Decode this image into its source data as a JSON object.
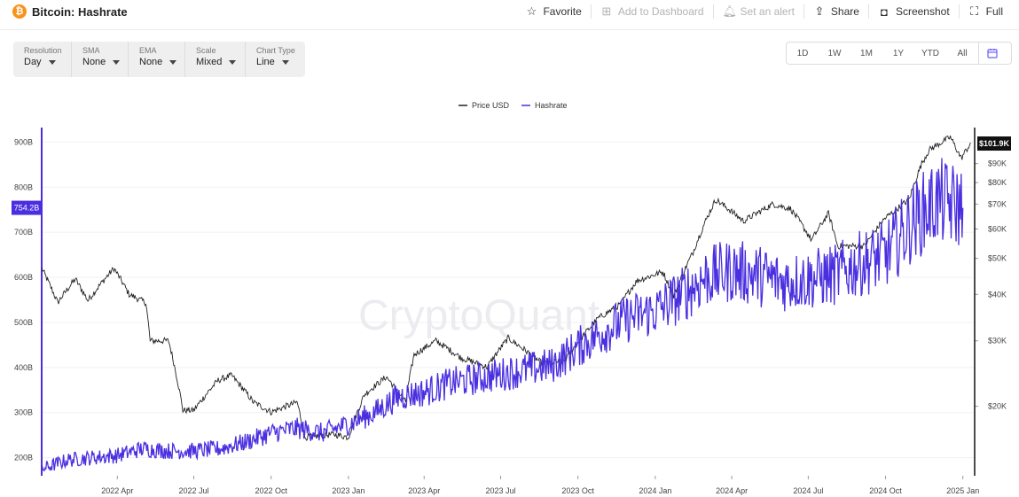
{
  "header": {
    "coin_symbol": "₿",
    "title": "Bitcoin: Hashrate",
    "actions": [
      {
        "label": "Favorite",
        "icon": "☆",
        "name": "favorite-button",
        "icon_name": "star-icon",
        "disabled": false
      },
      {
        "label": "Add to Dashboard",
        "icon": "⊞",
        "name": "add-to-dashboard-button",
        "icon_name": "dashboard-icon",
        "disabled": true
      },
      {
        "label": "Set an alert",
        "icon": "🔔︎",
        "name": "set-alert-button",
        "icon_name": "bell-icon",
        "disabled": true
      },
      {
        "label": "Share",
        "icon": "⇪",
        "name": "share-button",
        "icon_name": "share-icon",
        "disabled": false
      },
      {
        "label": "Screenshot",
        "icon": "◘",
        "name": "screenshot-button",
        "icon_name": "camera-icon",
        "disabled": false
      },
      {
        "label": "Full",
        "icon": "⛶",
        "name": "fullscreen-button",
        "icon_name": "expand-icon",
        "disabled": false
      }
    ]
  },
  "controls": [
    {
      "label": "Resolution",
      "value": "Day"
    },
    {
      "label": "SMA",
      "value": "None"
    },
    {
      "label": "EMA",
      "value": "None"
    },
    {
      "label": "Scale",
      "value": "Mixed"
    },
    {
      "label": "Chart Type",
      "value": "Line"
    }
  ],
  "ranges": [
    "1D",
    "1W",
    "1M",
    "1Y",
    "YTD",
    "All"
  ],
  "watermark": "CryptoQuant",
  "colors": {
    "hashrate": "#4a2fe0",
    "price": "#222222",
    "price_label_bg": "#111111",
    "hashrate_label_bg": "#4a2fe0"
  },
  "chart_data": {
    "type": "line",
    "legend": [
      "Price USD",
      "Hashrate"
    ],
    "legend_position": "top-center",
    "grid": true,
    "x_ticks": [
      "2022 Apr",
      "2022 Jul",
      "2022 Oct",
      "2023 Jan",
      "2023 Apr",
      "2023 Jul",
      "2023 Oct",
      "2024 Jan",
      "2024 Apr",
      "2024 Jul",
      "2024 Oct",
      "2025 Jan"
    ],
    "y_left_ticks": [
      "900B",
      "800B",
      "700B",
      "600B",
      "500B",
      "400B",
      "300B",
      "200B"
    ],
    "y_left_range": [
      160,
      940
    ],
    "y_right_ticks": [
      "$90K",
      "$80K",
      "$70K",
      "$60K",
      "$50K",
      "$40K",
      "$30K",
      "$20K"
    ],
    "y_right_scale": "log",
    "y_right_range": [
      13000,
      115000
    ],
    "x_range": [
      "2022-01-01",
      "2025-01-15"
    ],
    "last_values": {
      "hashrate": "754.2B",
      "price": "$101.9K"
    },
    "series": [
      {
        "name": "Hashrate",
        "axis": "left",
        "unit": "B",
        "points": [
          [
            "2022-01-01",
            175
          ],
          [
            "2022-02-01",
            195
          ],
          [
            "2022-03-01",
            200
          ],
          [
            "2022-04-01",
            205
          ],
          [
            "2022-05-01",
            220
          ],
          [
            "2022-06-01",
            215
          ],
          [
            "2022-07-01",
            215
          ],
          [
            "2022-08-01",
            220
          ],
          [
            "2022-09-01",
            235
          ],
          [
            "2022-10-01",
            255
          ],
          [
            "2022-11-01",
            265
          ],
          [
            "2022-12-01",
            255
          ],
          [
            "2023-01-01",
            275
          ],
          [
            "2023-02-01",
            300
          ],
          [
            "2023-03-01",
            335
          ],
          [
            "2023-04-01",
            345
          ],
          [
            "2023-05-01",
            365
          ],
          [
            "2023-06-01",
            375
          ],
          [
            "2023-07-01",
            385
          ],
          [
            "2023-08-01",
            395
          ],
          [
            "2023-09-01",
            405
          ],
          [
            "2023-10-01",
            445
          ],
          [
            "2023-11-01",
            480
          ],
          [
            "2023-12-01",
            510
          ],
          [
            "2024-01-01",
            525
          ],
          [
            "2024-02-01",
            560
          ],
          [
            "2024-03-01",
            600
          ],
          [
            "2024-04-01",
            615
          ],
          [
            "2024-05-01",
            605
          ],
          [
            "2024-06-01",
            590
          ],
          [
            "2024-07-01",
            595
          ],
          [
            "2024-08-01",
            605
          ],
          [
            "2024-09-01",
            630
          ],
          [
            "2024-10-01",
            650
          ],
          [
            "2024-11-01",
            720
          ],
          [
            "2024-12-01",
            770
          ],
          [
            "2025-01-01",
            754.2
          ]
        ]
      },
      {
        "name": "Price USD",
        "axis": "right",
        "unit": "USD",
        "points": [
          [
            "2022-01-01",
            47000
          ],
          [
            "2022-01-20",
            38000
          ],
          [
            "2022-02-10",
            44000
          ],
          [
            "2022-02-25",
            38500
          ],
          [
            "2022-03-28",
            47000
          ],
          [
            "2022-04-15",
            40000
          ],
          [
            "2022-05-05",
            38000
          ],
          [
            "2022-05-10",
            30000
          ],
          [
            "2022-06-01",
            30000
          ],
          [
            "2022-06-18",
            19500
          ],
          [
            "2022-07-01",
            19500
          ],
          [
            "2022-07-30",
            23500
          ],
          [
            "2022-08-15",
            24200
          ],
          [
            "2022-09-10",
            20500
          ],
          [
            "2022-10-01",
            19300
          ],
          [
            "2022-11-01",
            20500
          ],
          [
            "2022-11-10",
            16500
          ],
          [
            "2022-12-15",
            16800
          ],
          [
            "2023-01-01",
            16500
          ],
          [
            "2023-01-20",
            21500
          ],
          [
            "2023-02-15",
            24000
          ],
          [
            "2023-03-10",
            20500
          ],
          [
            "2023-03-20",
            27500
          ],
          [
            "2023-04-15",
            30000
          ],
          [
            "2023-05-15",
            27000
          ],
          [
            "2023-06-15",
            25500
          ],
          [
            "2023-07-10",
            30500
          ],
          [
            "2023-08-20",
            26000
          ],
          [
            "2023-09-15",
            26500
          ],
          [
            "2023-10-25",
            34500
          ],
          [
            "2023-11-20",
            37500
          ],
          [
            "2023-12-10",
            43500
          ],
          [
            "2024-01-10",
            46000
          ],
          [
            "2024-01-23",
            39500
          ],
          [
            "2024-02-15",
            52000
          ],
          [
            "2024-03-13",
            72000
          ],
          [
            "2024-04-15",
            63000
          ],
          [
            "2024-05-20",
            70000
          ],
          [
            "2024-06-10",
            68000
          ],
          [
            "2024-07-05",
            56000
          ],
          [
            "2024-07-25",
            66000
          ],
          [
            "2024-08-05",
            54000
          ],
          [
            "2024-09-06",
            54000
          ],
          [
            "2024-09-30",
            64000
          ],
          [
            "2024-10-29",
            72000
          ],
          [
            "2024-11-13",
            90000
          ],
          [
            "2024-11-22",
            98000
          ],
          [
            "2024-12-17",
            106000
          ],
          [
            "2024-12-30",
            93000
          ],
          [
            "2025-01-10",
            101900
          ]
        ]
      }
    ]
  }
}
